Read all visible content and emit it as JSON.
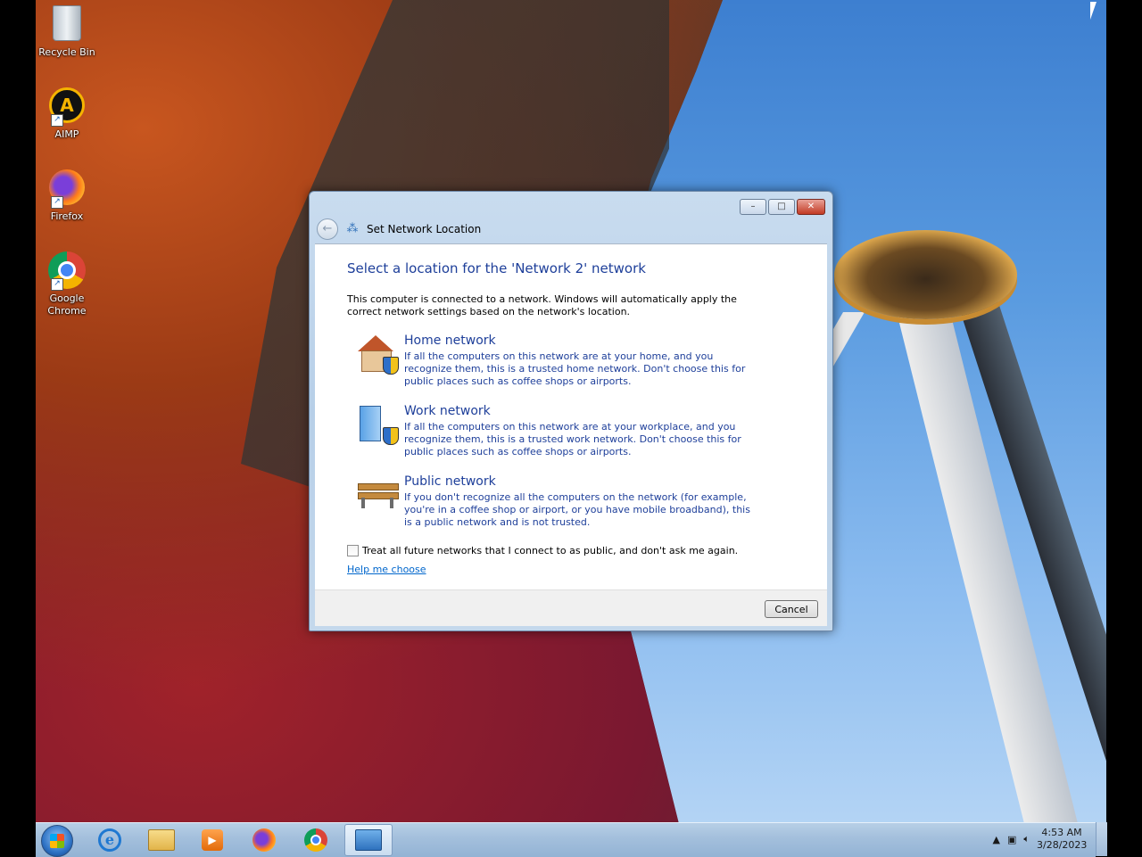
{
  "desktop_icons": [
    {
      "label": "Recycle Bin",
      "icon": "recycle-bin-icon"
    },
    {
      "label": "AIMP",
      "icon": "aimp-icon"
    },
    {
      "label": "Firefox",
      "icon": "firefox-icon"
    },
    {
      "label": "Google Chrome",
      "icon": "chrome-icon"
    }
  ],
  "dialog": {
    "title": "Set Network Location",
    "heading": "Select a location for the 'Network  2' network",
    "intro": "This computer is connected to a network. Windows will automatically apply the correct network settings based on the network's location.",
    "options": [
      {
        "title": "Home network",
        "description": "If all the computers on this network are at your home, and you recognize them, this is a trusted home network.  Don't choose this for public places such as coffee shops or airports.",
        "icon": "home-network-icon"
      },
      {
        "title": "Work network",
        "description": "If all the computers on this network are at your workplace, and you recognize them, this is a trusted work network.  Don't choose this for public places such as coffee shops or airports.",
        "icon": "work-network-icon"
      },
      {
        "title": "Public network",
        "description": "If you don't recognize all the computers on the network (for example, you're in a coffee shop or airport, or you have mobile broadband), this is a public network and is not trusted.",
        "icon": "public-network-icon"
      }
    ],
    "checkbox_label": "Treat all future networks that I connect to as public, and don't ask me again.",
    "checkbox_checked": false,
    "help_link": "Help me choose",
    "cancel_label": "Cancel",
    "window_buttons": {
      "minimize": "–",
      "maximize": "□",
      "close": "✕"
    }
  },
  "taskbar": {
    "pinned": [
      "internet-explorer-icon",
      "file-explorer-icon",
      "media-player-icon",
      "firefox-icon",
      "chrome-icon",
      "network-location-icon"
    ],
    "active": "network-location-icon",
    "clock_time": "4:53 AM",
    "clock_date": "3/28/2023"
  },
  "colors": {
    "heading_blue": "#1e3f9a",
    "link_blue": "#0066cc",
    "taskbar": "#a3bfdc"
  }
}
